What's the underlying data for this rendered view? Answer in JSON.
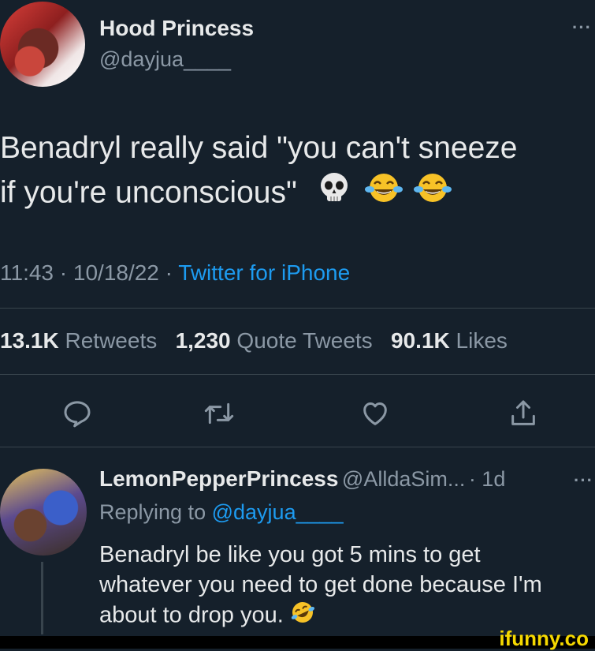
{
  "tweet": {
    "author_name": "Hood Princess",
    "author_handle": "@dayjua____",
    "more_label": "···",
    "text_line1": "Benadryl really said \"you can't sneeze",
    "text_line2": "if you're unconscious\"",
    "emojis": [
      "skull-emoji",
      "joy-emoji",
      "joy-emoji"
    ],
    "time": "11:43",
    "date": "10/18/22",
    "source": "Twitter for iPhone",
    "separator": " · "
  },
  "stats": {
    "retweets_count": "13.1K",
    "retweets_label": "Retweets",
    "quotes_count": "1,230",
    "quotes_label": "Quote Tweets",
    "likes_count": "90.1K",
    "likes_label": "Likes"
  },
  "actions": [
    "reply-icon",
    "retweet-icon",
    "like-icon",
    "share-icon"
  ],
  "reply": {
    "author_name": "LemonPepperPrincess",
    "author_handle": "@AlldaSim...",
    "time_ago": "· 1d",
    "more_label": "···",
    "replying_prefix": "Replying to",
    "replying_mention": "@dayjua____",
    "text_line1": "Benadryl be like you got 5 mins to get",
    "text_line2": "whatever you need to get done because I'm",
    "text_line3": "about to drop you.",
    "emoji": "rofl-emoji"
  },
  "watermark": "ifunny.co",
  "colors": {
    "background": "#15202b",
    "text": "#e7e9ea",
    "secondary": "#8b98a5",
    "link": "#1d9bf0",
    "divider": "#38444d",
    "watermark": "#f5d800"
  }
}
